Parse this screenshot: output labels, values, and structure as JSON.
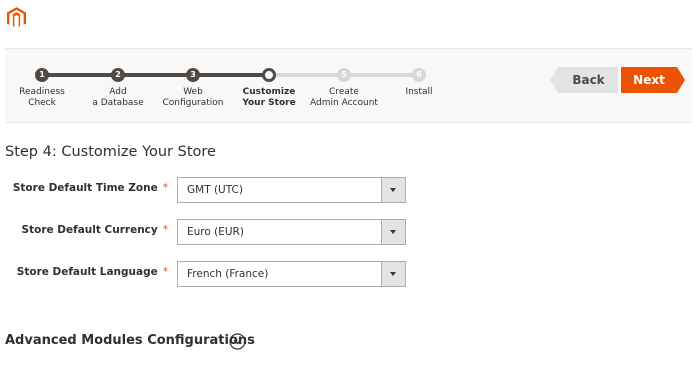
{
  "logo": {
    "icon": "magento-logo-icon",
    "color": "#eb5202"
  },
  "wizard": {
    "steps": [
      {
        "number": "1",
        "label": "Readiness\nCheck",
        "state": "done"
      },
      {
        "number": "2",
        "label": "Add\na Database",
        "state": "done"
      },
      {
        "number": "3",
        "label": "Web\nConfiguration",
        "state": "done"
      },
      {
        "number": "4",
        "label": "Customize\nYour Store",
        "state": "active"
      },
      {
        "number": "5",
        "label": "Create\nAdmin Account",
        "state": "todo"
      },
      {
        "number": "6",
        "label": "Install",
        "state": "todo"
      }
    ],
    "back_label": "Back",
    "next_label": "Next"
  },
  "page": {
    "title": "Step 4: Customize Your Store"
  },
  "form": {
    "required_mark": "*",
    "fields": [
      {
        "label": "Store Default Time Zone",
        "value": "GMT (UTC)"
      },
      {
        "label": "Store Default Currency",
        "value": "Euro (EUR)"
      },
      {
        "label": "Store Default Language",
        "value": "French (France)"
      }
    ]
  },
  "advanced": {
    "title": "Advanced Modules Configurations",
    "toggle_icon": "chevron-down-circle-icon"
  },
  "colors": {
    "accent": "#eb5202",
    "step_done": "#514943",
    "step_todo": "#d8d8d8"
  }
}
